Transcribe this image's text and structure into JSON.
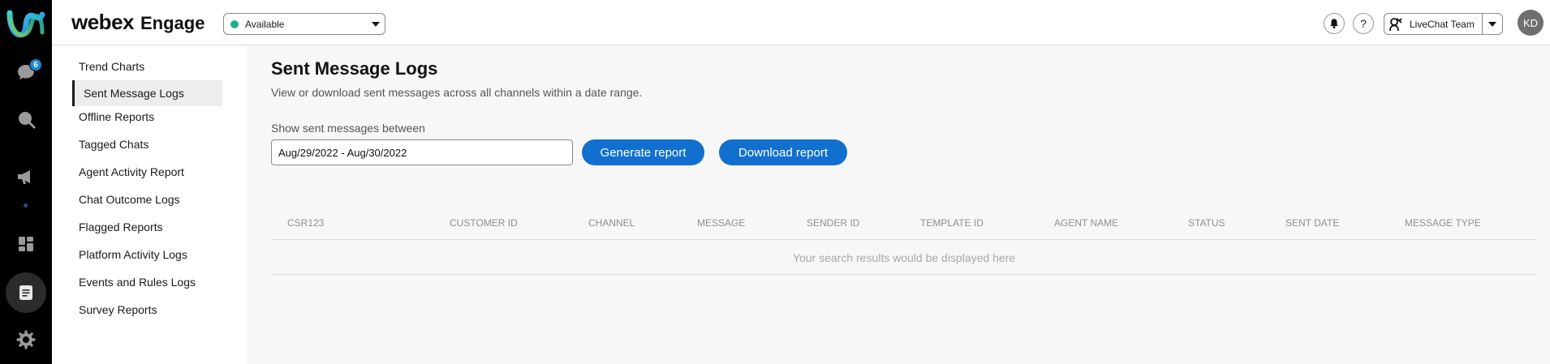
{
  "app": {
    "brand_name": "webex",
    "product_name": "Engage"
  },
  "rail": {
    "chat_badge": "6",
    "icons": [
      "chat-icon",
      "search-icon",
      "megaphone-icon",
      "dashboard-icon",
      "reports-icon",
      "settings-icon"
    ],
    "active": "reports-icon"
  },
  "topbar": {
    "status": "Available",
    "status_color": "#1fae8a",
    "help_label": "?",
    "team": "LiveChat Team",
    "avatar_initials": "KD"
  },
  "subnav": {
    "items": [
      "Trend Charts",
      "Sent Message Logs",
      "Offline Reports",
      "Tagged Chats",
      "Agent Activity Report",
      "Chat Outcome Logs",
      "Flagged Reports",
      "Platform Activity Logs",
      "Events and Rules Logs",
      "Survey Reports"
    ],
    "active_index": 1
  },
  "main": {
    "title": "Sent Message Logs",
    "subtitle": "View or download sent messages across all channels within a date range.",
    "range_label": "Show sent messages between",
    "date_range": "Aug/29/2022 - Aug/30/2022",
    "generate_label": "Generate report",
    "download_label": "Download report",
    "table": {
      "columns": [
        "CSR123",
        "CUSTOMER ID",
        "CHANNEL",
        "MESSAGE",
        "SENDER ID",
        "TEMPLATE ID",
        "AGENT NAME",
        "STATUS",
        "SENT DATE",
        "MESSAGE TYPE"
      ],
      "empty_text": "Your search results would be displayed here"
    }
  },
  "colors": {
    "accent": "#1170cf",
    "rail_bg": "#000000",
    "badge": "#1786d9"
  }
}
